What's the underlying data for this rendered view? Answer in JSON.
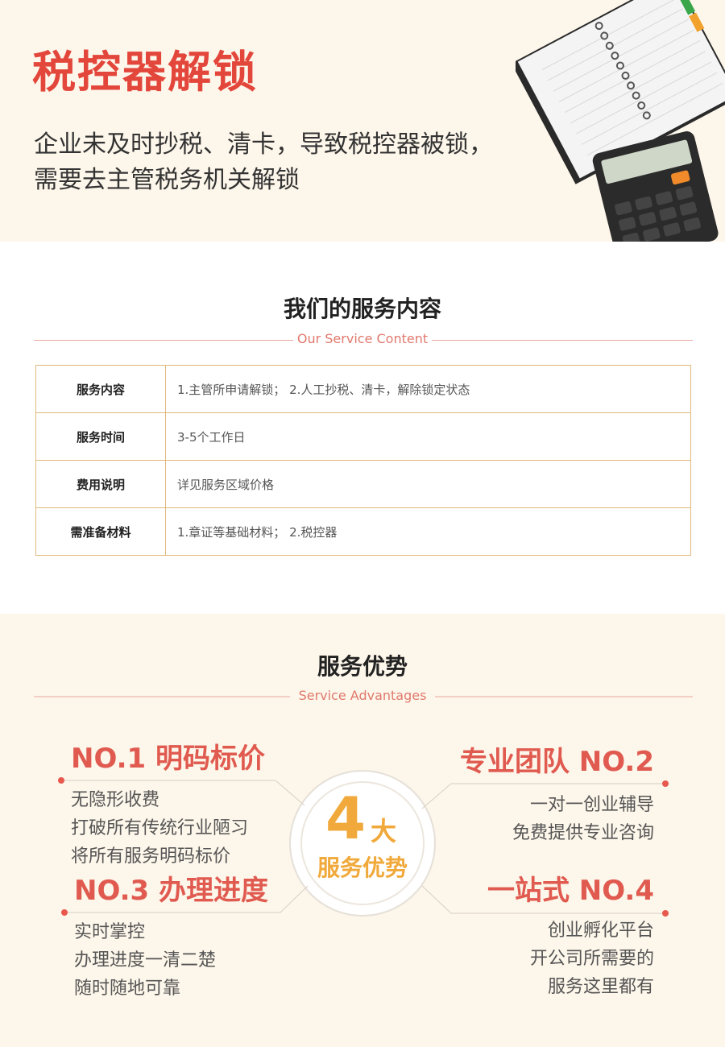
{
  "hero": {
    "title": "税控器解锁",
    "desc_line1": "企业未及时抄税、清卡，导致税控器被锁，",
    "desc_line2": "需要去主管税务机关解锁"
  },
  "service": {
    "title": "我们的服务内容",
    "subtitle": "Our Service Content",
    "rows": [
      {
        "key": "服务内容",
        "value": "1.主管所申请解锁； 2.人工抄税、清卡，解除锁定状态"
      },
      {
        "key": "服务时间",
        "value": "3-5个工作日"
      },
      {
        "key": "费用说明",
        "value": "详见服务区域价格"
      },
      {
        "key": "需准备材料",
        "value": "1.章证等基础材料；  2.税控器"
      }
    ]
  },
  "advantages": {
    "title": "服务优势",
    "subtitle": "Service Advantages",
    "center": {
      "number": "4",
      "suffix": "大",
      "label": "服务优势"
    },
    "items": [
      {
        "heading": "NO.1 明码标价",
        "lines": [
          "无隐形收费",
          "打破所有传统行业陋习",
          "将所有服务明码标价"
        ]
      },
      {
        "heading": "专业团队 NO.2",
        "lines": [
          "一对一创业辅导",
          "免费提供专业咨询"
        ]
      },
      {
        "heading": "NO.3 办理进度",
        "lines": [
          "实时掌控",
          "办理进度一清二楚",
          "随时随地可靠"
        ]
      },
      {
        "heading": "一站式 NO.4",
        "lines": [
          "创业孵化平台",
          "开公司所需要的",
          "服务这里都有"
        ]
      }
    ]
  },
  "colors": {
    "accent_red": "#e3463b",
    "accent_orange": "#f0a93a",
    "cream_bg": "#fdf6ea",
    "table_border": "#e0b97c"
  }
}
